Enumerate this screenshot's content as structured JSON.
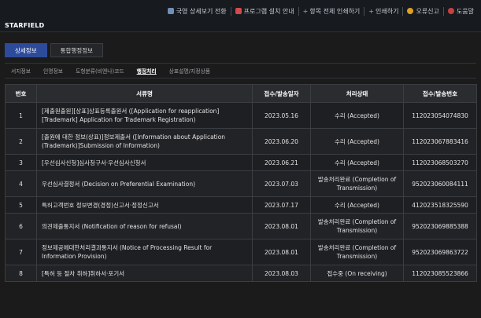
{
  "header": {
    "links": [
      {
        "icon": "monitor-icon",
        "label": "국영 상세보기 전환"
      },
      {
        "icon": "document-icon",
        "label": "프로그램 설치 안내"
      },
      {
        "icon": "plus-icon",
        "label": "항목 전체 인쇄하기"
      },
      {
        "icon": "plus-icon",
        "label": "인쇄하기"
      },
      {
        "icon": "warning-icon",
        "label": "오류신고"
      },
      {
        "icon": "help-icon",
        "label": "도움말"
      }
    ],
    "brand": "STARFIELD"
  },
  "tabs": [
    {
      "label": "상세정보",
      "active": true
    },
    {
      "label": "통합행정정보",
      "active": false
    }
  ],
  "subtabs": [
    {
      "label": "서지정보",
      "active": false
    },
    {
      "label": "인명정보",
      "active": false
    },
    {
      "label": "도형분류(비엔나)코드",
      "active": false
    },
    {
      "label": "행정처리",
      "active": true
    },
    {
      "label": "상표설명/지정상품",
      "active": false
    }
  ],
  "table": {
    "headers": [
      "번호",
      "서류명",
      "접수/발송일자",
      "처리상태",
      "접수/발송번호"
    ],
    "rows": [
      {
        "num": "1",
        "title": "[제출원출원][상표]상표등록출원서 ([Application for reapplication] [Trademark] Application for Trademark Registration)",
        "date": "2023.05.16",
        "status": "수리 (Accepted)",
        "no": "112023054074830"
      },
      {
        "num": "2",
        "title": "[출원에 대한 정보(상표)]정보제출서 ([Information about Application (Trademark)]Submission of Information)",
        "date": "2023.06.20",
        "status": "수리 (Accepted)",
        "no": "112023067883416"
      },
      {
        "num": "3",
        "title": "[우선심사신청]심사청구서·우선심사신청서",
        "date": "2023.06.21",
        "status": "수리 (Accepted)",
        "no": "112023068503270"
      },
      {
        "num": "4",
        "title": "우선심사결정서 (Decision on Preferential Examination)",
        "date": "2023.07.03",
        "status": "발송처리완료 (Completion of Transmission)",
        "no": "952023060084111"
      },
      {
        "num": "5",
        "title": "특허고객번호 정보변경(경정)신고서·정정신고서",
        "date": "2023.07.17",
        "status": "수리 (Accepted)",
        "no": "412023518325590"
      },
      {
        "num": "6",
        "title": "의견제출통지서 (Notification of reason for refusal)",
        "date": "2023.08.01",
        "status": "발송처리완료 (Completion of Transmission)",
        "no": "952023069885388"
      },
      {
        "num": "7",
        "title": "정보제공에대한처리결과통지서 (Notice of Processing Result for Information Provision)",
        "date": "2023.08.01",
        "status": "발송처리완료 (Completion of Transmission)",
        "no": "952023069863722"
      },
      {
        "num": "8",
        "title": "[특허 등 절차 취하]취하서·포기서",
        "date": "2023.08.03",
        "status": "접수중 (On receiving)",
        "no": "112023085523866"
      }
    ]
  },
  "colors": {
    "background": "#1b1b1b",
    "active_tab": "#2d4b9a",
    "header_cell": "#2a2c30"
  }
}
